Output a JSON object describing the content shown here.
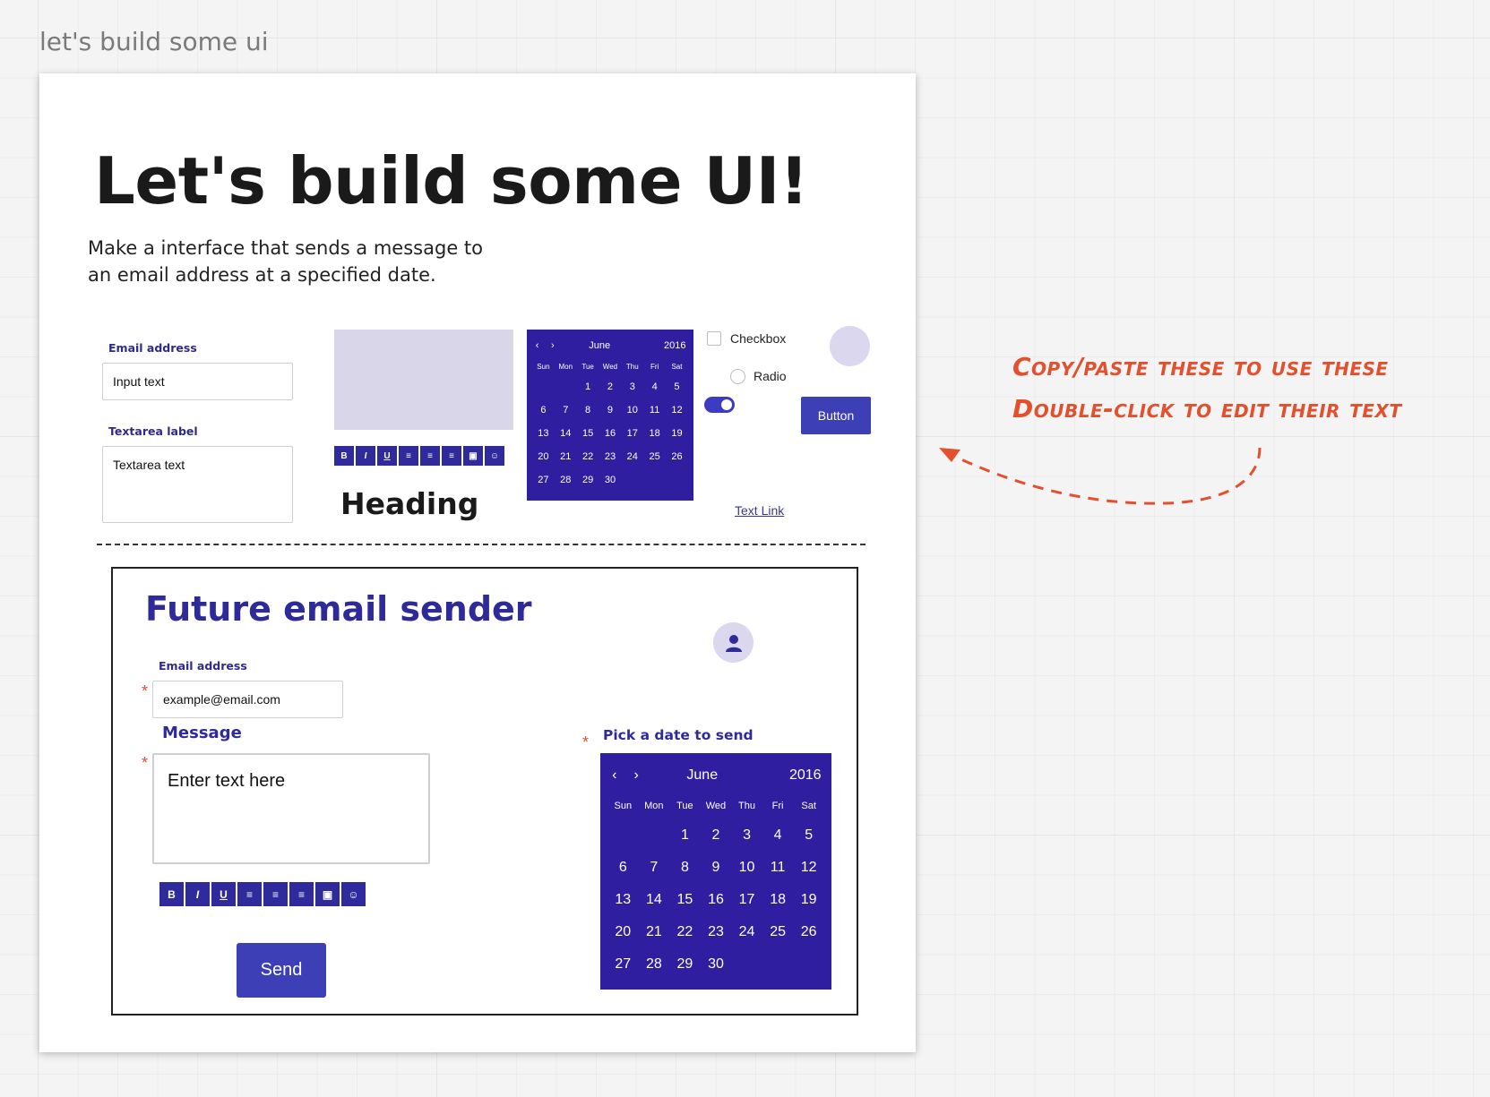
{
  "frame_title": "let's build some ui",
  "heading": "Let's build some UI!",
  "intro": "Make a interface that sends a message to an email address at a specified date.",
  "kit": {
    "email_label": "Email address",
    "input_value": "Input text",
    "textarea_label": "Textarea label",
    "textarea_value": "Textarea text",
    "heading": "Heading",
    "checkbox_label": "Checkbox",
    "radio_label": "Radio",
    "button_label": "Button",
    "text_link": "Text Link",
    "toggle_on": true
  },
  "toolbar": [
    {
      "label": "B",
      "icon": "bold-icon"
    },
    {
      "label": "I",
      "icon": "italic-icon"
    },
    {
      "label": "U",
      "icon": "underline-icon"
    },
    {
      "label": "≡",
      "icon": "align-left-icon"
    },
    {
      "label": "≡",
      "icon": "align-center-icon"
    },
    {
      "label": "≡",
      "icon": "align-right-icon"
    },
    {
      "label": "▣",
      "icon": "image-icon"
    },
    {
      "label": "☺",
      "icon": "emoji-icon"
    }
  ],
  "calendar": {
    "month": "June",
    "year": "2016",
    "prev": "‹",
    "next": "›",
    "weekdays": [
      "Sun",
      "Mon",
      "Tue",
      "Wed",
      "Thu",
      "Fri",
      "Sat"
    ],
    "weeks": [
      [
        "",
        "",
        "1",
        "2",
        "3",
        "4",
        "5"
      ],
      [
        "6",
        "7",
        "8",
        "9",
        "10",
        "11",
        "12"
      ],
      [
        "13",
        "14",
        "15",
        "16",
        "17",
        "18",
        "19"
      ],
      [
        "20",
        "21",
        "22",
        "23",
        "24",
        "25",
        "26"
      ],
      [
        "27",
        "28",
        "29",
        "30",
        "",
        "",
        ""
      ]
    ]
  },
  "sender": {
    "title": "Future email sender",
    "email_label": "Email address",
    "email_value": "example@email.com",
    "message_label": "Message",
    "message_placeholder": "Enter text here",
    "pick_label": "Pick a date to send",
    "required_mark": "*",
    "send_label": "Send"
  },
  "annotation": {
    "line1": "Copy/paste these to use these",
    "line2": "Double-click to edit their text",
    "color": "#e2502d"
  },
  "colors": {
    "primary": "#2f1fa0",
    "accent": "#3d3fb6",
    "light": "#d8d6e8"
  }
}
